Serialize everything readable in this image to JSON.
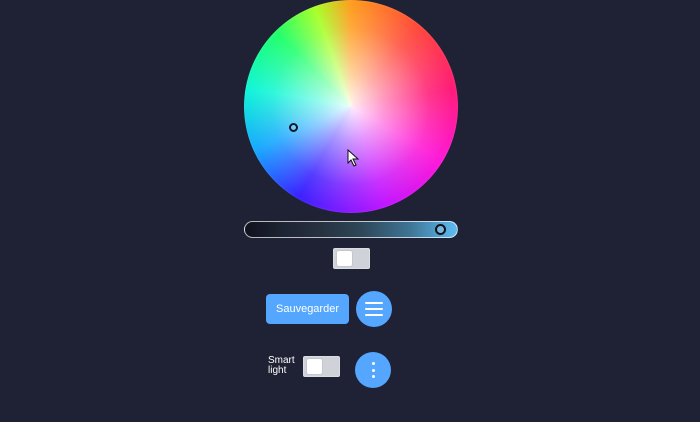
{
  "colors": {
    "background": "#1f2235",
    "accent": "#55a6ff",
    "switch_track": "#cfd2d8",
    "switch_knob": "#ffffff"
  },
  "icons": {
    "menu": "hamburger-icon",
    "more": "kebab-icon",
    "cursor": "mouse-pointer-icon"
  },
  "color_picker": {
    "brightness": 0.92
  },
  "actions": {
    "save_label": "Sauvegarder"
  },
  "smart_light": {
    "label_line1": "Smart",
    "label_line2": "light"
  }
}
